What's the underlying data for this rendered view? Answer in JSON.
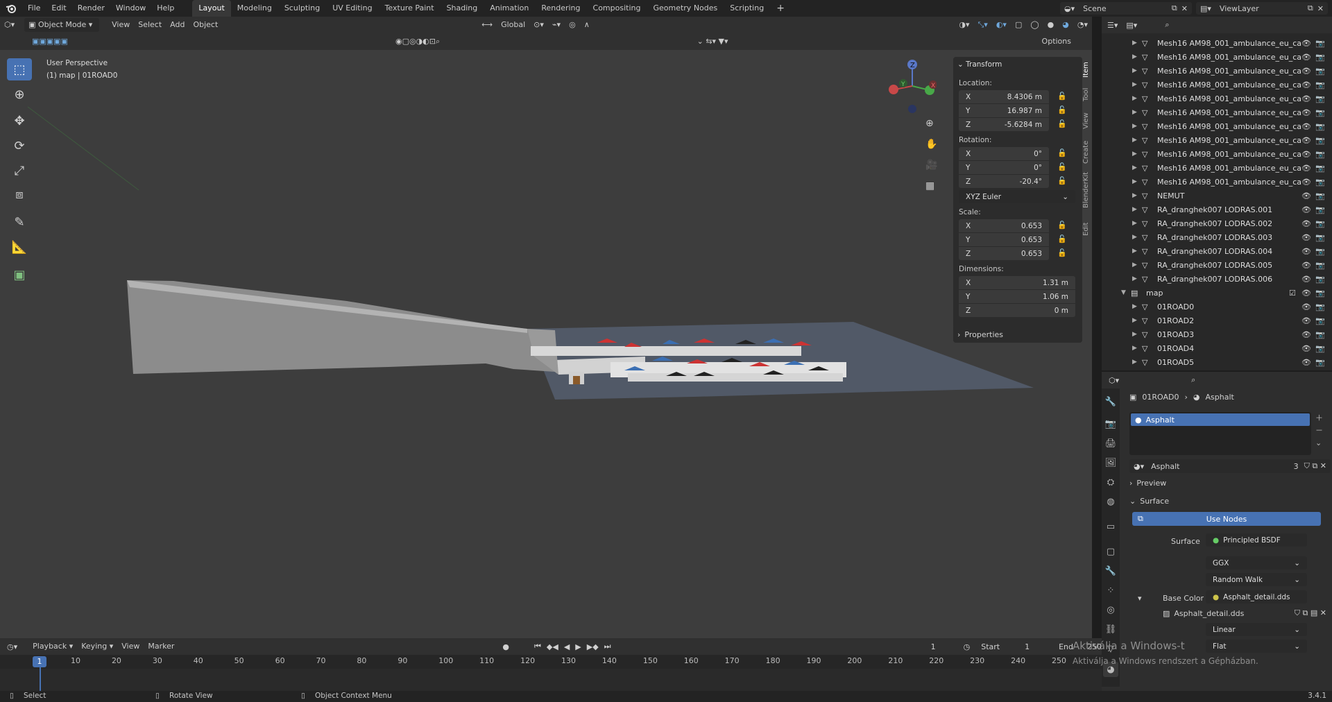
{
  "app": {
    "logo": "blender-logo-icon",
    "version": "3.4.1"
  },
  "menu": [
    "File",
    "Edit",
    "Render",
    "Window",
    "Help"
  ],
  "workspaces": [
    "Layout",
    "Modeling",
    "Sculpting",
    "UV Editing",
    "Texture Paint",
    "Shading",
    "Animation",
    "Rendering",
    "Compositing",
    "Geometry Nodes",
    "Scripting",
    "+"
  ],
  "active_workspace": "Layout",
  "scene": {
    "label": "Scene",
    "view_layer": "ViewLayer"
  },
  "viewport": {
    "mode": "Object Mode",
    "menus": [
      "View",
      "Select",
      "Add",
      "Object"
    ],
    "orientation": "Global",
    "options": "Options",
    "perspective": "User Perspective",
    "selection_info": "(1) map | 01ROAD0"
  },
  "transform": {
    "title": "Transform",
    "location_label": "Location:",
    "location": {
      "x": "8.4306 m",
      "y": "16.987 m",
      "z": "-5.6284 m"
    },
    "rotation_label": "Rotation:",
    "rotation": {
      "x": "0°",
      "y": "0°",
      "z": "-20.4°"
    },
    "rotation_mode": "XYZ Euler",
    "scale_label": "Scale:",
    "scale": {
      "x": "0.653",
      "y": "0.653",
      "z": "0.653"
    },
    "dimensions_label": "Dimensions:",
    "dimensions": {
      "x": "1.31 m",
      "y": "1.06 m",
      "z": "0 m"
    },
    "axis": {
      "x": "X",
      "y": "Y",
      "z": "Z"
    },
    "properties": "Properties"
  },
  "sidebar_tabs": [
    "Item",
    "Tool",
    "View",
    "Create",
    "BlenderKit",
    "Edit"
  ],
  "outliner": {
    "rows": [
      {
        "name": "Mesh16 AM98_001_ambulance_eu_ca",
        "indent": 2
      },
      {
        "name": "Mesh16 AM98_001_ambulance_eu_ca",
        "indent": 2
      },
      {
        "name": "Mesh16 AM98_001_ambulance_eu_ca",
        "indent": 2
      },
      {
        "name": "Mesh16 AM98_001_ambulance_eu_ca",
        "indent": 2
      },
      {
        "name": "Mesh16 AM98_001_ambulance_eu_ca",
        "indent": 2
      },
      {
        "name": "Mesh16 AM98_001_ambulance_eu_ca",
        "indent": 2
      },
      {
        "name": "Mesh16 AM98_001_ambulance_eu_ca",
        "indent": 2
      },
      {
        "name": "Mesh16 AM98_001_ambulance_eu_ca",
        "indent": 2
      },
      {
        "name": "Mesh16 AM98_001_ambulance_eu_ca",
        "indent": 2
      },
      {
        "name": "Mesh16 AM98_001_ambulance_eu_ca",
        "indent": 2
      },
      {
        "name": "Mesh16 AM98_001_ambulance_eu_ca",
        "indent": 2
      },
      {
        "name": "NEMUT",
        "indent": 2
      },
      {
        "name": "RA_dranghek007 LODRAS.001",
        "indent": 2
      },
      {
        "name": "RA_dranghek007 LODRAS.002",
        "indent": 2
      },
      {
        "name": "RA_dranghek007 LODRAS.003",
        "indent": 2
      },
      {
        "name": "RA_dranghek007 LODRAS.004",
        "indent": 2
      },
      {
        "name": "RA_dranghek007 LODRAS.005",
        "indent": 2
      },
      {
        "name": "RA_dranghek007 LODRAS.006",
        "indent": 2
      },
      {
        "name": "map",
        "indent": 1
      },
      {
        "name": "01ROAD0",
        "indent": 2
      },
      {
        "name": "01ROAD2",
        "indent": 2
      },
      {
        "name": "01ROAD3",
        "indent": 2
      },
      {
        "name": "01ROAD4",
        "indent": 2
      },
      {
        "name": "01ROAD5",
        "indent": 2
      }
    ]
  },
  "properties": {
    "breadcrumb_object": "01ROAD0",
    "breadcrumb_material": "Asphalt",
    "slot": "Asphalt",
    "material_name": "Asphalt",
    "users": "3",
    "preview": "Preview",
    "surface_section": "Surface",
    "use_nodes": "Use Nodes",
    "surface_label": "Surface",
    "surface_value": "Principled BSDF",
    "distribution": "GGX",
    "subsurface": "Random Walk",
    "base_color_label": "Base Color",
    "base_color_value": "Asphalt_detail.dds",
    "image_name": "Asphalt_detail.dds",
    "interp": "Linear",
    "projection": "Flat"
  },
  "timeline": {
    "menus": [
      "Playback",
      "Keying",
      "View",
      "Marker"
    ],
    "current_frame": "1",
    "start_label": "Start",
    "start": "1",
    "end_label": "End",
    "end": "250",
    "ticks": [
      "1",
      "10",
      "20",
      "30",
      "40",
      "50",
      "60",
      "70",
      "80",
      "90",
      "100",
      "110",
      "120",
      "130",
      "140",
      "150",
      "160",
      "170",
      "180",
      "190",
      "200",
      "210",
      "220",
      "230",
      "240",
      "250"
    ]
  },
  "status": {
    "select": "Select",
    "rotate": "Rotate View",
    "context": "Object Context Menu"
  },
  "watermark": {
    "line1": "Aktiválja a Windows-t",
    "line2": "Aktiválja a Windows rendszert a Gépházban."
  }
}
